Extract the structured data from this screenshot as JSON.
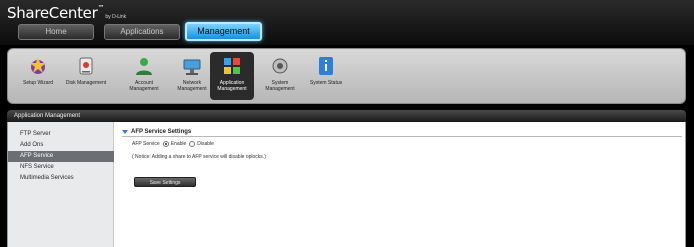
{
  "brand": {
    "name": "ShareCenter",
    "trademark": "™",
    "sub": "by D-Link"
  },
  "nav": {
    "tabs": [
      {
        "label": "Home",
        "active": false
      },
      {
        "label": "Applications",
        "active": false
      },
      {
        "label": "Management",
        "active": true
      }
    ]
  },
  "toolbar": {
    "items": [
      {
        "label": "Setup Wizard",
        "icon": "wizard-icon"
      },
      {
        "label": "Disk Management",
        "icon": "disk-icon"
      },
      {
        "label": "Account Management",
        "icon": "account-icon"
      },
      {
        "label": "Network Management",
        "icon": "network-icon"
      },
      {
        "label": "Application Management",
        "icon": "app-grid-icon",
        "selected": true
      },
      {
        "label": "System Management",
        "icon": "system-icon"
      },
      {
        "label": "System Status",
        "icon": "info-icon"
      }
    ]
  },
  "section": {
    "title": "Application Management"
  },
  "sidebar": {
    "items": [
      {
        "label": "FTP Server"
      },
      {
        "label": "Add Ons"
      },
      {
        "label": "AFP Service",
        "active": true
      },
      {
        "label": "NFS Service"
      },
      {
        "label": "Multimedia Services"
      }
    ]
  },
  "panel": {
    "title": "AFP Service Settings",
    "afp_label": "AFP Service",
    "enable_label": "Enable",
    "disable_label": "Disable",
    "selected": "Enable",
    "notice": "( Notice: Adding a share to AFP service will disable oplocks.)",
    "save_label": "Save Settings"
  },
  "colors": {
    "accent": "#1a8fe0",
    "selected_bg": "#6b6e73"
  }
}
